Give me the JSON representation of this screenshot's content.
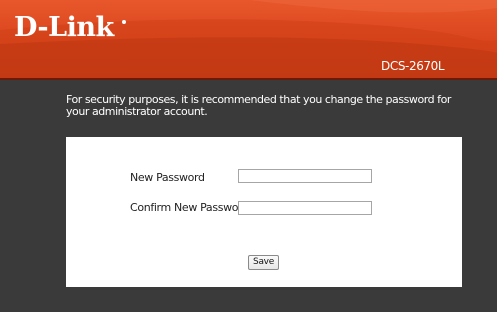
{
  "brand": {
    "logo_text": "D-Link",
    "model": "DCS-2670L",
    "header_color": "#d9441c"
  },
  "message": "For security purposes, it is recommended that you change the password for your administrator account.",
  "form": {
    "new_password_label": "New Password",
    "new_password_value": "",
    "confirm_password_label": "Confirm New Password",
    "confirm_password_value": "",
    "save_label": "Save"
  }
}
